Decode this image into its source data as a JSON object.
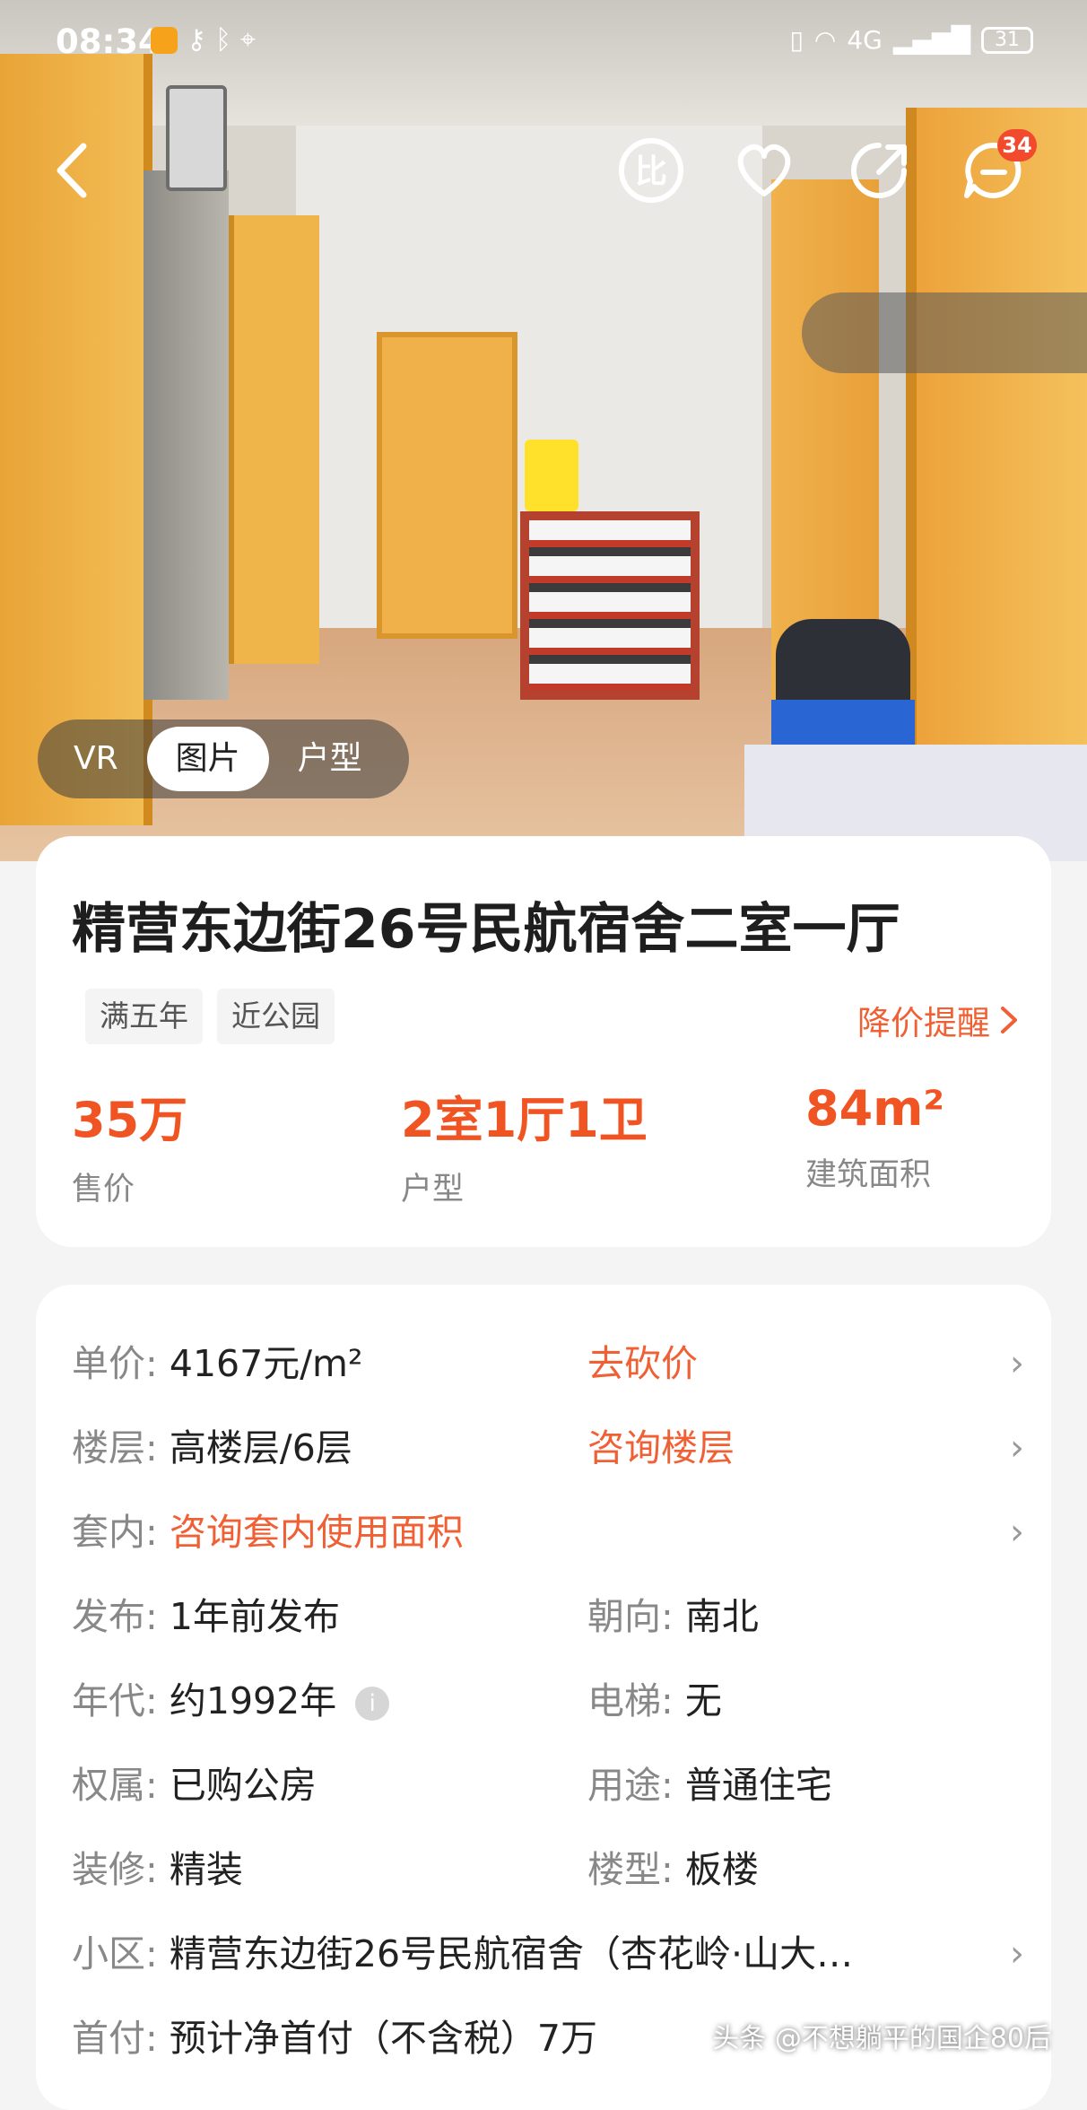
{
  "status_bar": {
    "time": "08:34",
    "network": "4G",
    "battery": "31"
  },
  "nav": {
    "chat_badge": "34"
  },
  "media_tabs": [
    {
      "label": "VR",
      "active": false
    },
    {
      "label": "图片",
      "active": true
    },
    {
      "label": "户型",
      "active": false
    }
  ],
  "listing": {
    "title": "精营东边街26号民航宿舍二室一厅",
    "tags": [
      "满五年",
      "近公园"
    ],
    "price_alert": "降价提醒",
    "stats": [
      {
        "value": "35万",
        "label": "售价"
      },
      {
        "value": "2室1厅1卫",
        "label": "户型"
      },
      {
        "value": "84m²",
        "label": "建筑面积"
      }
    ]
  },
  "details": {
    "unit_price_key": "单价:",
    "unit_price": "4167元/m²",
    "bargain": "去砍价",
    "floor_key": "楼层:",
    "floor": "高楼层/6层",
    "ask_floor": "咨询楼层",
    "inner_key": "套内:",
    "inner": "咨询套内使用面积",
    "publish_key": "发布:",
    "publish": "1年前发布",
    "orientation_key": "朝向:",
    "orientation": "南北",
    "era_key": "年代:",
    "era": "约1992年",
    "elevator_key": "电梯:",
    "elevator": "无",
    "ownership_key": "权属:",
    "ownership": "已购公房",
    "usage_key": "用途:",
    "usage": "普通住宅",
    "decoration_key": "装修:",
    "decoration": "精装",
    "building_type_key": "楼型:",
    "building_type": "板楼",
    "community_key": "小区:",
    "community": "精营东边街26号民航宿舍（杏花岭·山大…",
    "down_payment_key": "首付:",
    "down_payment": "预计净首付（不含税）7万"
  },
  "watermark": "头条 @不想躺平的国企80后",
  "colors": {
    "accent": "#f05423",
    "link": "#f06035",
    "badge": "#f24a2c"
  }
}
